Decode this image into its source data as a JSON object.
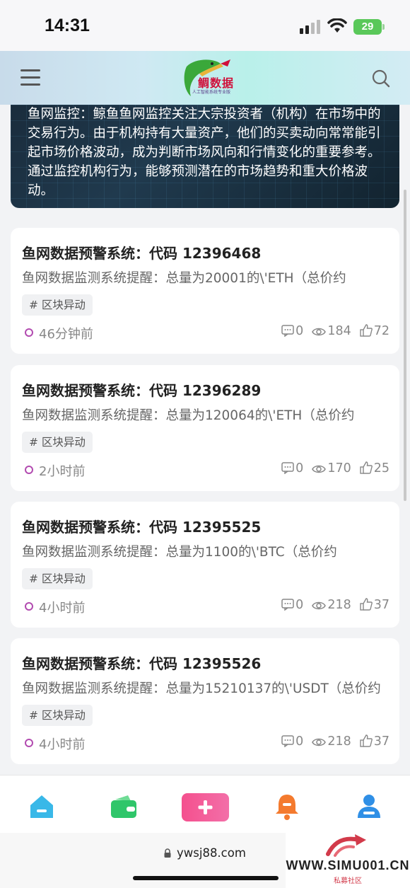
{
  "status_bar": {
    "time": "14:31",
    "battery": "29"
  },
  "header": {
    "logo_text": "鲷数据",
    "logo_sub": "人工智能系统专业版",
    "menu_icon": "hamburger-icon",
    "search_icon": "search-icon"
  },
  "banner": {
    "text": "鱼网监控：鲸鱼鱼网监控关注大宗投资者（机构）在市场中的交易行为。由于机构持有大量资产，他们的买卖动向常常能引起市场价格波动，成为判断市场风向和行情变化的重要参考。通过监控机构行为，能够预测潜在的市场趋势和重大价格波动。"
  },
  "cards": [
    {
      "title": "鱼网数据预警系统：代码 12396468",
      "desc": "鱼网数据监测系统提醒：总量为20001的\\'ETH（总价约",
      "tag": "# 区块异动",
      "time": "46分钟前",
      "comments": "0",
      "views": "184",
      "likes": "72"
    },
    {
      "title": "鱼网数据预警系统：代码 12396289",
      "desc": "鱼网数据监测系统提醒：总量为120064的\\'ETH（总价约",
      "tag": "# 区块异动",
      "time": "2小时前",
      "comments": "0",
      "views": "170",
      "likes": "25"
    },
    {
      "title": "鱼网数据预警系统：代码 12395525",
      "desc": "鱼网数据监测系统提醒：总量为1100的\\'BTC（总价约",
      "tag": "# 区块异动",
      "time": "4小时前",
      "comments": "0",
      "views": "218",
      "likes": "37"
    },
    {
      "title": "鱼网数据预警系统：代码 12395526",
      "desc": "鱼网数据监测系统提醒：总量为15210137的\\'USDT（总价约",
      "tag": "# 区块异动",
      "time": "4小时前",
      "comments": "0",
      "views": "218",
      "likes": "37"
    }
  ],
  "bottom_nav": {
    "items": [
      "home-icon",
      "wallet-icon",
      "add-icon",
      "bell-icon",
      "user-icon"
    ],
    "colors": {
      "home": "#39b8e8",
      "wallet": "#2fc66a",
      "add": "#f4508e",
      "bell": "#f47a2e",
      "user": "#2f8fe6"
    }
  },
  "browser": {
    "url": "ywsj88.com"
  },
  "watermark": {
    "text": "WWW.SIMU001.CN",
    "sub": "私募社区"
  }
}
